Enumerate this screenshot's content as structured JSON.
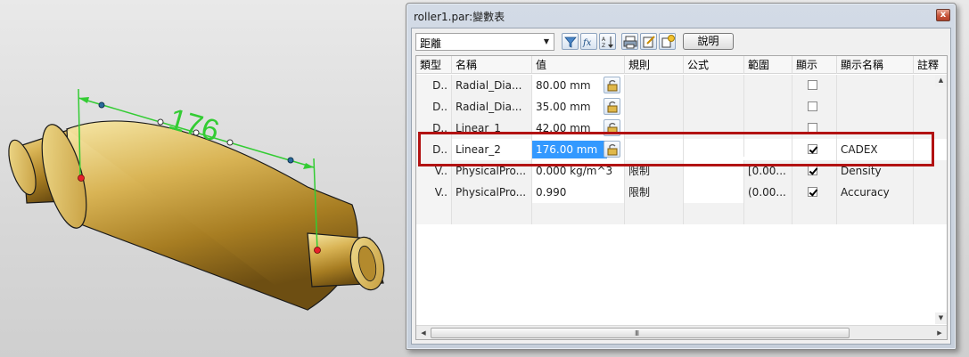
{
  "viewport": {
    "dimension_text": "176",
    "colors": {
      "body": "#c9a236",
      "dimension": "#33cc33",
      "point": "#e8202a"
    }
  },
  "dialog": {
    "title": "roller1.par:變數表",
    "close_label": "x",
    "toolbar": {
      "type_select_value": "距離",
      "help_label": "說明",
      "buttons": [
        "filter-icon",
        "formula-icon",
        "sort-icon",
        "print-icon",
        "edit-icon",
        "add-icon"
      ]
    },
    "grid": {
      "headers": [
        "類型",
        "名稱",
        "值",
        "規則",
        "公式",
        "範圍",
        "顯示",
        "顯示名稱",
        "註釋"
      ],
      "rows": [
        {
          "type": "D..",
          "name": "Radial_Dia...",
          "value": "80.00 mm",
          "rule": "",
          "formula": "",
          "range": "",
          "show": false,
          "display_name": ""
        },
        {
          "type": "D..",
          "name": "Radial_Dia...",
          "value": "35.00 mm",
          "rule": "",
          "formula": "",
          "range": "",
          "show": false,
          "display_name": ""
        },
        {
          "type": "D..",
          "name": "Linear_1",
          "value": "42.00 mm",
          "rule": "",
          "formula": "",
          "range": "",
          "show": false,
          "display_name": ""
        },
        {
          "type": "D..",
          "name": "Linear_2",
          "value": "176.00 mm",
          "rule": "",
          "formula": "",
          "range": "",
          "show": true,
          "display_name": "CADEX"
        },
        {
          "type": "V..",
          "name": "PhysicalPro...",
          "value": "0.000 kg/m^3",
          "rule": "限制",
          "formula": "",
          "range": "[0.00...",
          "show": true,
          "display_name": "Density"
        },
        {
          "type": "V..",
          "name": "PhysicalPro...",
          "value": "0.990",
          "rule": "限制",
          "formula": "",
          "range": "(0.00...",
          "show": true,
          "display_name": "Accuracy"
        }
      ]
    },
    "scrollbar": {
      "grip": "III"
    },
    "highlight_color": "#b21212"
  }
}
